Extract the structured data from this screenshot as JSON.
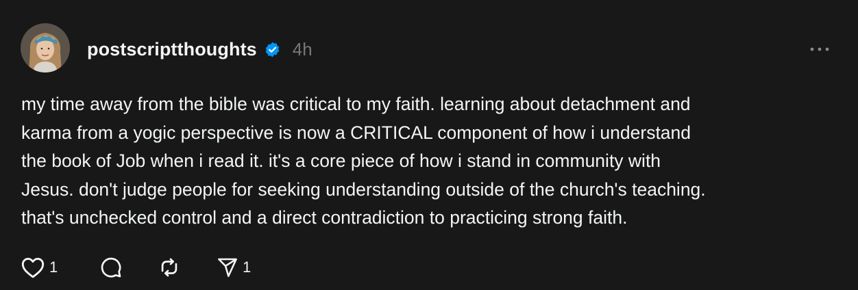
{
  "post": {
    "author": {
      "username": "postscriptthoughts",
      "verified": true,
      "avatar_icon": "profile-photo"
    },
    "timestamp": "4h",
    "body": "my time away from the bible was critical to my faith. learning about detachment and\nkarma from a yogic perspective is now a CRITICAL component of how i understand\nthe book of Job when i read it. it's a core piece of how i stand in community with\nJesus. don't judge people for seeking understanding outside of the church's teaching.\nthat's unchecked control and a direct contradiction to practicing strong faith.",
    "actions": {
      "like": {
        "icon": "heart-icon",
        "count": "1"
      },
      "reply": {
        "icon": "comment-icon",
        "count": ""
      },
      "repost": {
        "icon": "repost-icon",
        "count": ""
      },
      "share": {
        "icon": "send-icon",
        "count": "1"
      }
    }
  },
  "colors": {
    "background": "#181818",
    "text": "#f3f5f7",
    "muted": "#777777",
    "verified_badge": "#0095f6"
  }
}
